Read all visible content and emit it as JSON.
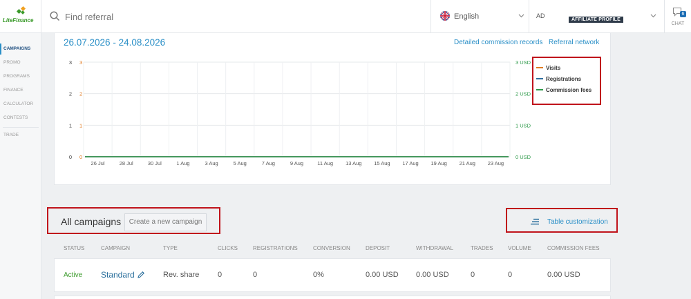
{
  "header": {
    "logo_text": "LiteFinance",
    "search_placeholder": "Find referral",
    "language": "English",
    "user_initials": "AD",
    "affiliate_badge": "AFFILIATE PROFILE",
    "chat_count": "6",
    "chat_label": "CHAT"
  },
  "sidebar": {
    "items": [
      {
        "label": "CAMPAIGNS",
        "active": true
      },
      {
        "label": "PROMO"
      },
      {
        "label": "PROGRAMS"
      },
      {
        "label": "FINANCE"
      },
      {
        "label": "CALCULATOR"
      },
      {
        "label": "CONTESTS"
      },
      {
        "label": "TRADE"
      }
    ]
  },
  "stats": {
    "date_range": "26.07.2026 - 24.08.2026",
    "link_commission_records": "Detailed commission records",
    "link_referral_network": "Referral network"
  },
  "chart_data": {
    "type": "line",
    "x": [
      "26 Jul",
      "28 Jul",
      "30 Jul",
      "1 Aug",
      "3 Aug",
      "5 Aug",
      "7 Aug",
      "9 Aug",
      "11 Aug",
      "13 Aug",
      "15 Aug",
      "17 Aug",
      "19 Aug",
      "21 Aug",
      "23 Aug"
    ],
    "series": [
      {
        "name": "Visits",
        "color": "#e07b22",
        "values": [
          0,
          0,
          0,
          0,
          0,
          0,
          0,
          0,
          0,
          0,
          0,
          0,
          0,
          0,
          0
        ]
      },
      {
        "name": "Registrations",
        "color": "#2f6f9f",
        "values": [
          0,
          0,
          0,
          0,
          0,
          0,
          0,
          0,
          0,
          0,
          0,
          0,
          0,
          0,
          0
        ]
      },
      {
        "name": "Commission fees",
        "color": "#2e9a4a",
        "values": [
          0,
          0,
          0,
          0,
          0,
          0,
          0,
          0,
          0,
          0,
          0,
          0,
          0,
          0,
          0
        ]
      }
    ],
    "y_left_ticks": [
      "0",
      "1",
      "2",
      "3"
    ],
    "y_left2_ticks": [
      "0",
      "1",
      "2",
      "3"
    ],
    "y_right_ticks": [
      "0 USD",
      "1 USD",
      "2 USD",
      "3 USD"
    ],
    "ylim": [
      0,
      3
    ],
    "grid": true,
    "legend_position": "top-right",
    "tick_colors": {
      "left": "#444444",
      "left2": "#e07b22",
      "right": "#2e9a4a"
    }
  },
  "campaigns": {
    "title": "All campaigns",
    "create_button": "Create a new campaign",
    "table_customization": "Table customization",
    "columns": [
      "STATUS",
      "CAMPAIGN",
      "TYPE",
      "CLICKS",
      "REGISTRATIONS",
      "CONVERSION",
      "DEPOSIT",
      "WITHDRAWAL",
      "TRADES",
      "VOLUME",
      "COMMISSION FEES"
    ],
    "rows": [
      {
        "status": "Active",
        "campaign": "Standard",
        "type": "Rev. share",
        "clicks": "0",
        "registrations": "0",
        "conversion": "0%",
        "deposit": "0.00 USD",
        "withdrawal": "0.00 USD",
        "trades": "0",
        "volume": "0",
        "commission_fees": "0.00 USD"
      }
    ]
  },
  "colors": {
    "accent": "#2a8fc7",
    "active_green": "#3a9a2a",
    "highlight_red": "#c0131b",
    "badge_dark": "#2f3b4a"
  }
}
